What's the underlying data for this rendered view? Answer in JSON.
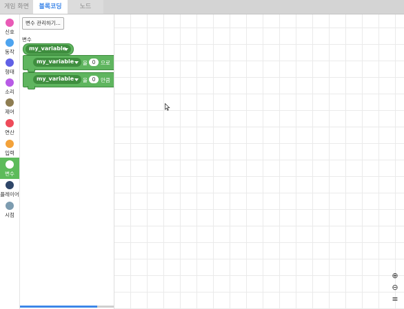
{
  "tabs": [
    {
      "label": "게임 화면",
      "active": false
    },
    {
      "label": "블록코딩",
      "active": true
    },
    {
      "label": "노드",
      "active": false
    }
  ],
  "categories": [
    {
      "label": "신호",
      "color": "#e95bb6"
    },
    {
      "label": "동작",
      "color": "#4ea4ef"
    },
    {
      "label": "형태",
      "color": "#6161e6"
    },
    {
      "label": "소리",
      "color": "#b85be6"
    },
    {
      "label": "제어",
      "color": "#8e7d52"
    },
    {
      "label": "연산",
      "color": "#ee4b5a"
    },
    {
      "label": "입력",
      "color": "#f3a23a"
    },
    {
      "label": "변수",
      "color": "#ffffff",
      "active": true
    },
    {
      "label": "플레이어",
      "color": "#2f4668"
    },
    {
      "label": "시점",
      "color": "#7d9cb0"
    }
  ],
  "palette": {
    "manage_button": "변수 관리하기...",
    "section_label": "변수",
    "reporter_variable": "my_variable",
    "set_block": {
      "variable": "my_variable",
      "particle": "을",
      "value": "0",
      "suffix": "으로"
    },
    "change_block": {
      "variable": "my_variable",
      "particle": "을",
      "value": "0",
      "suffix": "만큼"
    },
    "accent_color": "#5fb55f"
  },
  "workspace": {
    "zoom_in": "⊕",
    "zoom_out": "⊖",
    "menu": "≡"
  }
}
